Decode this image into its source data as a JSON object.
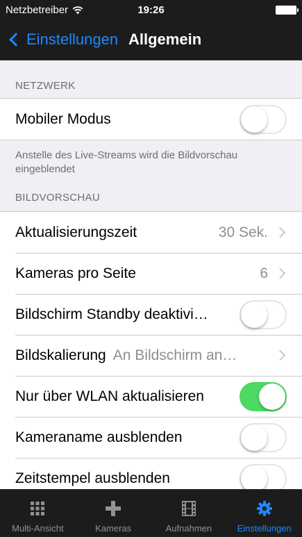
{
  "status_bar": {
    "carrier": "Netzbetreiber",
    "time": "19:26"
  },
  "nav": {
    "back_label": "Einstellungen",
    "title": "Allgemein"
  },
  "sections": {
    "network": {
      "header": "NETZWERK",
      "rows": [
        {
          "label": "Mobiler Modus",
          "toggle": false
        }
      ],
      "footer": "Anstelle des Live-Streams wird die Bildvorschau eingeblendet"
    },
    "preview": {
      "header": "BILDVORSCHAU",
      "rows": [
        {
          "label": "Aktualisierungszeit",
          "value": "30 Sek."
        },
        {
          "label": "Kameras pro Seite",
          "value": "6"
        },
        {
          "label": "Bildschirm Standby deaktivi…",
          "toggle": false
        },
        {
          "label": "Bildskalierung",
          "value": "An Bildschirm an…"
        },
        {
          "label": "Nur über WLAN aktualisieren",
          "toggle": true
        },
        {
          "label": "Kameraname ausblenden",
          "toggle": false
        },
        {
          "label": "Zeitstempel ausblenden",
          "toggle": false
        }
      ]
    }
  },
  "tabs": [
    {
      "label": "Multi-Ansicht",
      "icon": "grid-icon"
    },
    {
      "label": "Kameras",
      "icon": "plus-icon"
    },
    {
      "label": "Aufnahmen",
      "icon": "film-icon"
    },
    {
      "label": "Einstellungen",
      "icon": "gear-icon",
      "active": true
    }
  ],
  "colors": {
    "accent": "#1e88ff",
    "toggle_on": "#4cd964",
    "bar_background": "#1c1c1c",
    "page_background": "#efeff4"
  }
}
